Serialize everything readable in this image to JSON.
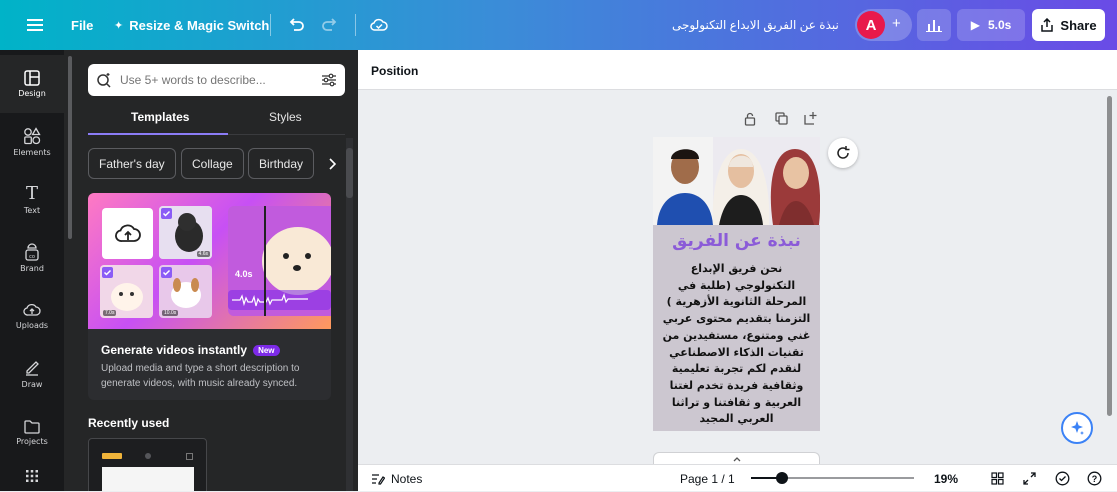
{
  "topbar": {
    "file_label": "File",
    "resize_label": "Resize & Magic Switch",
    "doc_title": "نبذة عن الفريق الابداع التكنولوجى",
    "avatar_letter": "A",
    "play_duration": "5.0s",
    "share_label": "Share"
  },
  "rail": {
    "items": [
      {
        "label": "Design",
        "icon": "layout-icon"
      },
      {
        "label": "Elements",
        "icon": "shapes-icon"
      },
      {
        "label": "Text",
        "icon": "text-icon"
      },
      {
        "label": "Brand",
        "icon": "brand-icon"
      },
      {
        "label": "Uploads",
        "icon": "cloud-upload-icon"
      },
      {
        "label": "Draw",
        "icon": "pen-icon"
      },
      {
        "label": "Projects",
        "icon": "folder-icon"
      }
    ]
  },
  "panel": {
    "search_placeholder": "Use 5+ words to describe...",
    "tabs": [
      "Templates",
      "Styles"
    ],
    "chips": [
      "Father's day",
      "Collage",
      "Birthday"
    ],
    "promo": {
      "badge_time": "4.0s",
      "thumb_labels": [
        "4.6s",
        "7.0s",
        "10.0s"
      ],
      "title": "Generate videos instantly",
      "new_badge": "New",
      "description": "Upload media and type a short description to generate videos, with music already synced."
    },
    "recent_title": "Recently used"
  },
  "editor": {
    "position_label": "Position",
    "slide": {
      "title": "نبذة عن الفريق",
      "body": "نحن فريق الإبداع التكنولوجي (طلبة في المرحلة الثانوية الأزهرية ) التزمنا بتقديم محتوى عربي غني ومتنوع، مستفيدين من تقنيات الذكاء الاصطناعي لنقدم لكم تجربة تعليمية وثقافية فريدة تخدم لغتنا العربية و ثقافتنا و تراثنا العربي المجيد",
      "background": "#ccc7d0",
      "title_color": "#8b5bd8"
    }
  },
  "bottombar": {
    "notes_label": "Notes",
    "page_label": "Page 1 / 1",
    "zoom_value": "19%",
    "zoom_fraction": 0.19
  },
  "colors": {
    "topbar_start": "#00b3c8",
    "topbar_end": "#6a4be6",
    "avatar": "#e8194b",
    "accent": "#8b7cf6"
  }
}
